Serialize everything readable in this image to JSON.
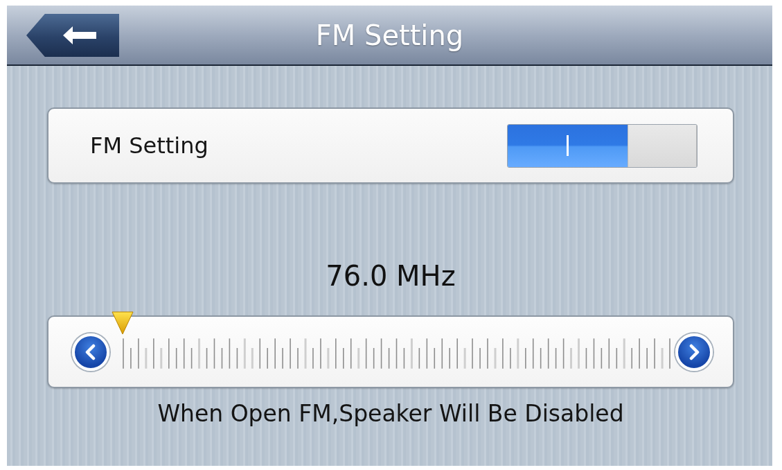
{
  "header": {
    "title": "FM Setting"
  },
  "setting": {
    "label": "FM Setting",
    "on": true
  },
  "tuner": {
    "frequency": "76.0 MHz",
    "level": 0
  },
  "note": "When Open FM,Speaker Will Be Disabled"
}
